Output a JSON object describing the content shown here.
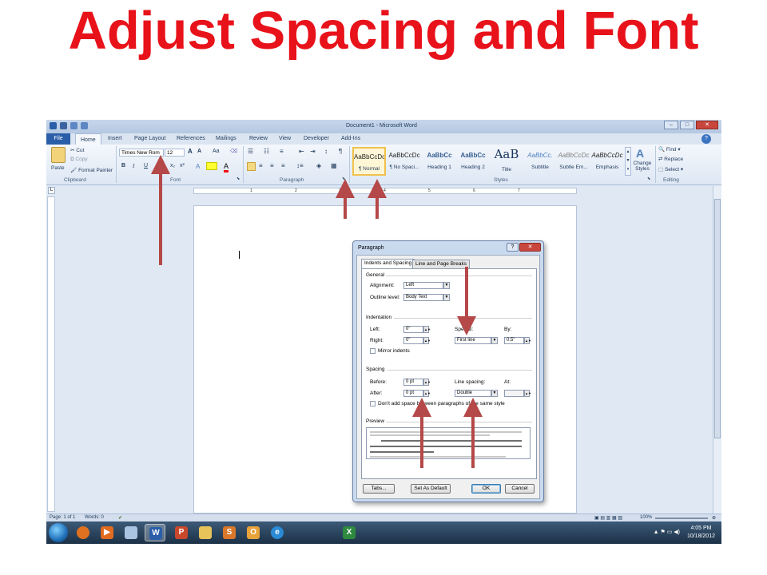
{
  "slide": {
    "title": "Adjust Spacing and Font"
  },
  "word": {
    "window_title": "Document1 - Microsoft Word",
    "tabs": [
      "File",
      "Home",
      "Insert",
      "Page Layout",
      "References",
      "Mailings",
      "Review",
      "View",
      "Developer",
      "Add-Ins"
    ],
    "clipboard": {
      "paste": "Paste",
      "cut": "Cut",
      "copy": "Copy",
      "format_painter": "Format Painter",
      "label": "Clipboard"
    },
    "font": {
      "name": "Times New Rom",
      "size": "12",
      "label": "Font",
      "bold": "B",
      "italic": "I",
      "underline": "U",
      "grow": "A",
      "shrink": "A",
      "change_case": "Aa"
    },
    "paragraph": {
      "label": "Paragraph"
    },
    "styles": {
      "label": "Styles",
      "items": [
        {
          "sample": "AaBbCcDc",
          "name": "¶ Normal"
        },
        {
          "sample": "AaBbCcDc",
          "name": "¶ No Spaci..."
        },
        {
          "sample": "AaBbCc",
          "name": "Heading 1"
        },
        {
          "sample": "AaBbCc",
          "name": "Heading 2"
        },
        {
          "sample": "AaB",
          "name": "Title"
        },
        {
          "sample": "AaBbCc.",
          "name": "Subtitle"
        },
        {
          "sample": "AaBbCcDc",
          "name": "Subtle Em..."
        },
        {
          "sample": "AaBbCcDc",
          "name": "Emphasis"
        }
      ],
      "change_styles": "Change Styles"
    },
    "editing": {
      "label": "Editing",
      "find": "Find",
      "replace": "Replace",
      "select": "Select"
    },
    "ruler_numbers": [
      "1",
      "2",
      "3",
      "4",
      "5",
      "6",
      "7"
    ],
    "status": {
      "page": "Page: 1 of 1",
      "words": "Words: 0",
      "zoom": "100%"
    },
    "taskbar": {
      "time": "4:05 PM",
      "date": "10/18/2012"
    }
  },
  "dialog": {
    "title": "Paragraph",
    "help": "?",
    "close": "✕",
    "tabs": [
      "Indents and Spacing",
      "Line and Page Breaks"
    ],
    "general": {
      "heading": "General",
      "alignment_label": "Alignment:",
      "alignment_value": "Left",
      "outline_label": "Outline level:",
      "outline_value": "Body Text"
    },
    "indentation": {
      "heading": "Indentation",
      "left_label": "Left:",
      "left_value": "0\"",
      "right_label": "Right:",
      "right_value": "0\"",
      "special_label": "Special:",
      "special_value": "First line",
      "by_label": "By:",
      "by_value": "0.5\"",
      "mirror_label": "Mirror indents"
    },
    "spacing": {
      "heading": "Spacing",
      "before_label": "Before:",
      "before_value": "0 pt",
      "after_label": "After:",
      "after_value": "0 pt",
      "line_label": "Line spacing:",
      "line_value": "Double",
      "at_label": "At:",
      "at_value": "",
      "dont_add_label": "Don't add space between paragraphs of the same style"
    },
    "preview": {
      "heading": "Preview"
    },
    "buttons": {
      "tabs": "Tabs...",
      "default": "Set As Default",
      "ok": "OK",
      "cancel": "Cancel"
    }
  },
  "colors": {
    "title_red": "#e8121a",
    "arrow": "#b54848",
    "ribbon": "#dde7f4",
    "file_tab": "#2a5ea8"
  }
}
